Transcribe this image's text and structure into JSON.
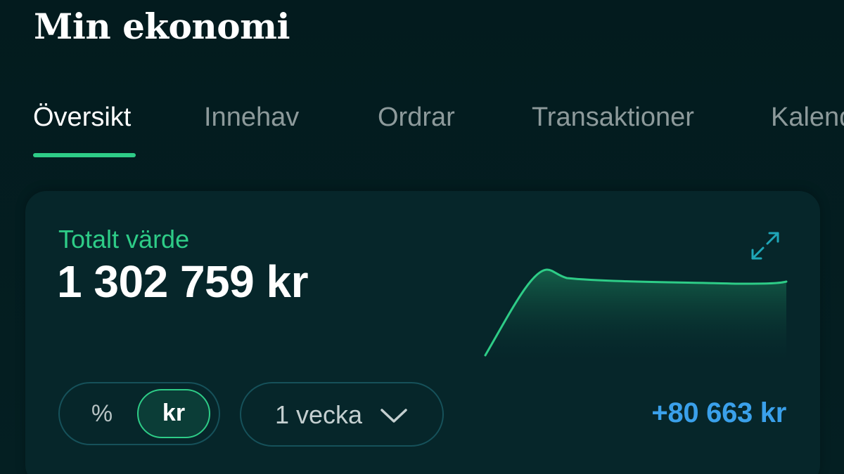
{
  "header": {
    "title": "Min ekonomi"
  },
  "tabs": [
    {
      "label": "Översikt",
      "active": true
    },
    {
      "label": "Innehav",
      "active": false
    },
    {
      "label": "Ordrar",
      "active": false
    },
    {
      "label": "Transaktioner",
      "active": false
    },
    {
      "label": "Kalender",
      "active": false
    }
  ],
  "summary": {
    "label": "Totalt värde",
    "value": "1 302 759 kr",
    "expand_icon": "expand-icon",
    "unit_toggle": {
      "options": [
        "%",
        "kr"
      ],
      "selected": "kr"
    },
    "period": {
      "label": "1 vecka",
      "icon": "chevron-down-icon"
    },
    "change": "+80 663 kr"
  },
  "colors": {
    "accent": "#2ecc87",
    "positive_change": "#3aa0ea",
    "background": "#031c1f",
    "card": "#06262a"
  }
}
